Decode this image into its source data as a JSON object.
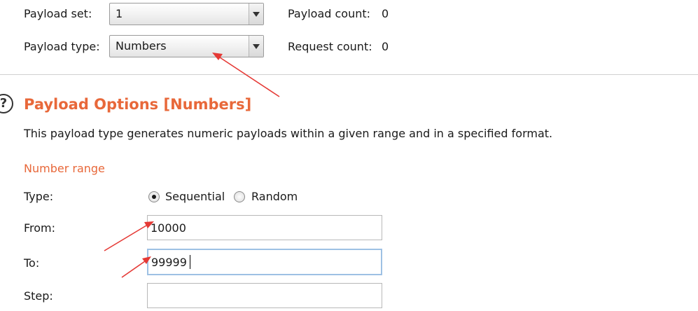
{
  "top": {
    "payload_set_label": "Payload set:",
    "payload_set_value": "1",
    "payload_type_label": "Payload type:",
    "payload_type_value": "Numbers",
    "payload_count_label": "Payload count:",
    "payload_count_value": "0",
    "request_count_label": "Request count:",
    "request_count_value": "0"
  },
  "section": {
    "help_glyph": "?",
    "title": "Payload Options [Numbers]",
    "description": "This payload type generates numeric payloads within a given range and in a specified format.",
    "number_range_heading": "Number range"
  },
  "form": {
    "type_label": "Type:",
    "sequential_label": "Sequential",
    "random_label": "Random",
    "selected_type": "Sequential",
    "from_label": "From:",
    "from_value": "10000",
    "to_label": "To:",
    "to_value": "99999",
    "step_label": "Step:",
    "step_value": ""
  },
  "colors": {
    "accent": "#e8683a",
    "annotation_arrow": "#e53935",
    "focus_border": "#9ec1e4"
  },
  "icons": [
    "help-icon",
    "dropdown-arrow-icon",
    "radio-icon"
  ]
}
